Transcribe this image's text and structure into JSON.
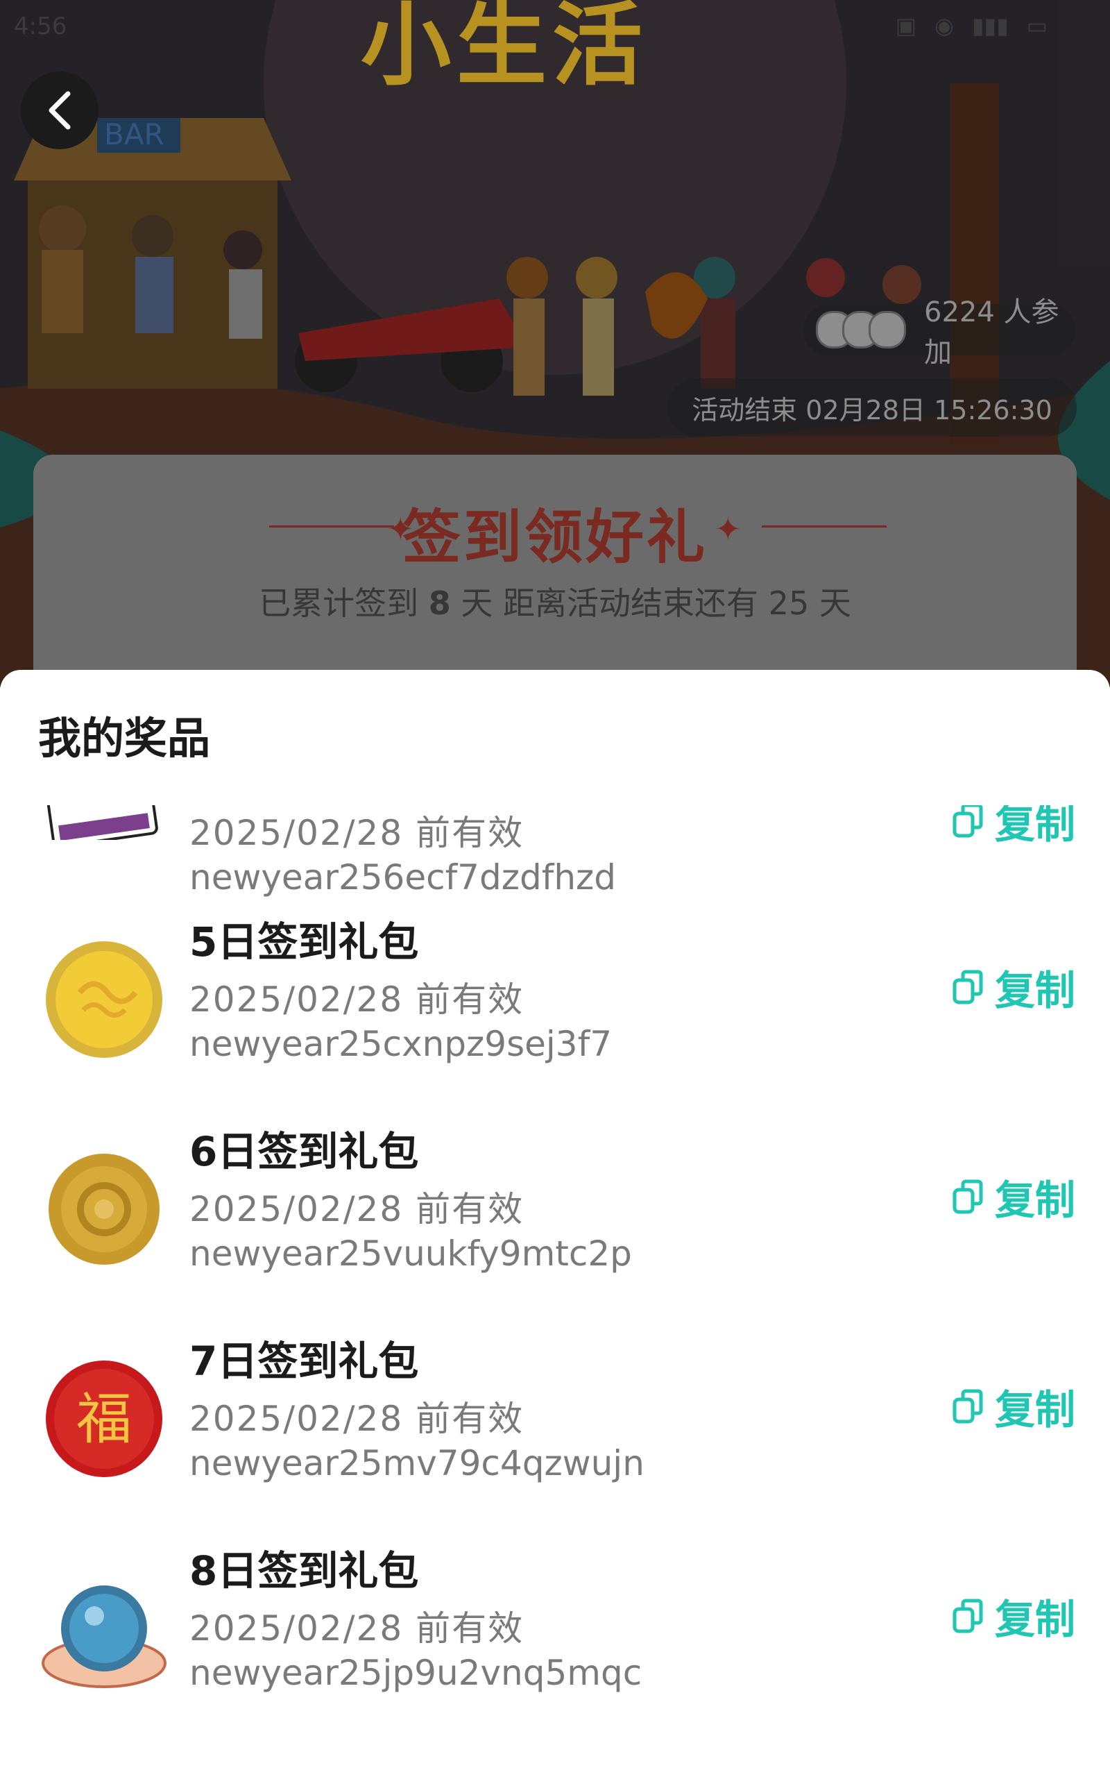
{
  "status_bar": {
    "time": "4:56",
    "icons": [
      "hd-icon",
      "eye-icon",
      "signal-icon",
      "battery-icon"
    ]
  },
  "banner": {
    "title": "小生活",
    "bar_sign": "BAR",
    "participants_text": "6224 人参加",
    "countdown_text": "活动结束 02月28日 15:26:30"
  },
  "signin": {
    "title": "签到领好礼",
    "sub_prefix": "已累计签到",
    "days_signed": "8",
    "sub_mid": "天  距离活动结束还有",
    "days_left": "25",
    "sub_suffix": "天"
  },
  "sheet": {
    "title": "我的奖品",
    "prizes": [
      {
        "name": "",
        "date": "2025/02/28 前有效",
        "code": "newyear256ecf7dzdfhzd",
        "copy_label": "复制",
        "icon": "voucher-card-icon"
      },
      {
        "name": "5日签到礼包",
        "date": "2025/02/28 前有效",
        "code": "newyear25cxnpz9sej3f7",
        "copy_label": "复制",
        "icon": "gold-coin-icon"
      },
      {
        "name": "6日签到礼包",
        "date": "2025/02/28 前有效",
        "code": "newyear25vuukfy9mtc2p",
        "copy_label": "复制",
        "icon": "bronze-coin-icon"
      },
      {
        "name": "7日签到礼包",
        "date": "2025/02/28 前有效",
        "code": "newyear25mv79c4qzwujn",
        "copy_label": "复制",
        "icon": "fu-coin-icon"
      },
      {
        "name": "8日签到礼包",
        "date": "2025/02/28 前有效",
        "code": "newyear25jp9u2vnq5mqc",
        "copy_label": "复制",
        "icon": "crystal-ball-icon"
      }
    ]
  },
  "colors": {
    "accent": "#1fc6b2",
    "title_red": "#7a2a20"
  }
}
